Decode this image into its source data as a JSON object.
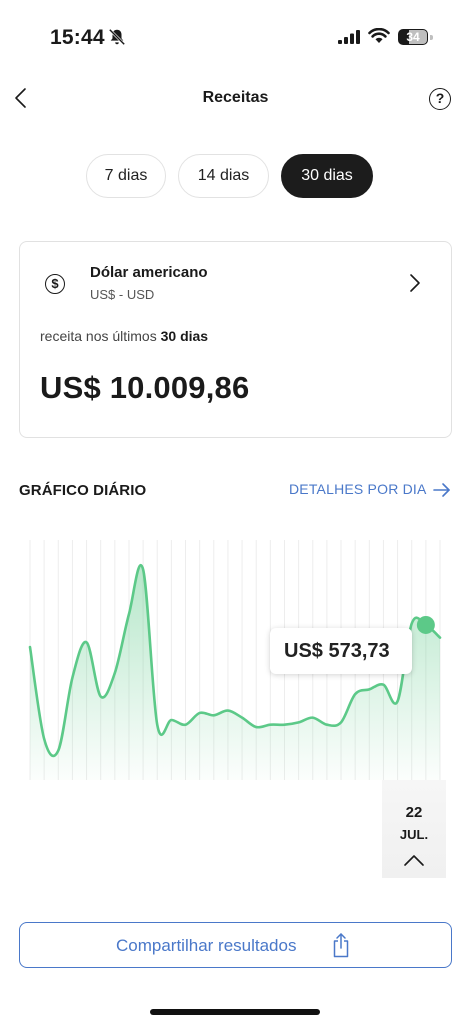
{
  "status_bar": {
    "time": "15:44",
    "battery": "34",
    "battery_level": 0.34
  },
  "header": {
    "title": "Receitas",
    "help_icon": "?"
  },
  "periods": [
    {
      "label": "7 dias",
      "active": false
    },
    {
      "label": "14 dias",
      "active": false
    },
    {
      "label": "30 dias",
      "active": true
    }
  ],
  "currency_card": {
    "icon_symbol": "$",
    "name": "Dólar americano",
    "code": "US$ - USD",
    "revenue_prefix": "receita nos últimos",
    "revenue_period": "30 dias",
    "revenue_value": "US$ 10.009,86"
  },
  "chart_section": {
    "title": "GRÁFICO DIÁRIO",
    "details_link": "DETALHES POR DIA",
    "tooltip_value": "US$ 573,73",
    "selected_day": "22",
    "selected_month": "JUL."
  },
  "chart_data": {
    "type": "area",
    "x": [
      1,
      2,
      3,
      4,
      5,
      6,
      7,
      8,
      9,
      10,
      11,
      12,
      13,
      14,
      15,
      16,
      17,
      18,
      19,
      20,
      21,
      22,
      23,
      24,
      25,
      26,
      27,
      28,
      29,
      30
    ],
    "values": [
      480,
      90,
      40,
      350,
      500,
      270,
      370,
      620,
      810,
      150,
      170,
      150,
      200,
      190,
      210,
      180,
      140,
      150,
      150,
      160,
      180,
      150,
      160,
      280,
      300,
      320,
      250,
      580,
      574,
      520
    ],
    "note_selected_index": 28,
    "color": "#5cc988",
    "title": "",
    "xlabel": "",
    "ylabel": ""
  },
  "share_button": {
    "label": "Compartilhar resultados"
  },
  "colors": {
    "accent": "#4a78c9",
    "chart": "#5cc988",
    "dark": "#1c1c1c"
  }
}
